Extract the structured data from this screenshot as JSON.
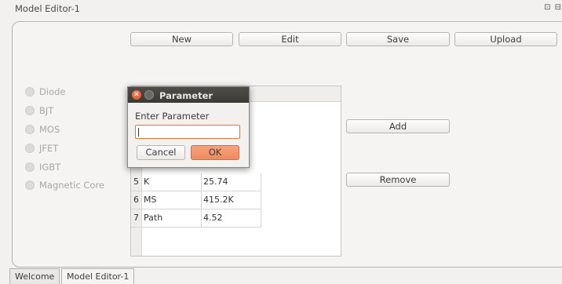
{
  "window": {
    "title": "Model Editor-1",
    "corner_icons": "⊡ ⊟"
  },
  "toolbar": {
    "new_label": "New",
    "edit_label": "Edit",
    "save_label": "Save",
    "upload_label": "Upload"
  },
  "device_types": [
    {
      "label": "Diode"
    },
    {
      "label": "BJT"
    },
    {
      "label": "MOS"
    },
    {
      "label": "JFET"
    },
    {
      "label": "IGBT"
    },
    {
      "label": "Magnetic Core"
    }
  ],
  "parameters": {
    "rows": [
      {
        "index": "5",
        "name": "K",
        "value": "25.74"
      },
      {
        "index": "6",
        "name": "MS",
        "value": "415.2K"
      },
      {
        "index": "7",
        "name": "Path",
        "value": "4.52"
      }
    ]
  },
  "actions": {
    "add_label": "Add",
    "remove_label": "Remove"
  },
  "tabs": [
    {
      "label": "Welcome"
    },
    {
      "label": "Model Editor-1"
    }
  ],
  "dialog": {
    "title": "Parameter",
    "prompt": "Enter Parameter",
    "input_value": "",
    "cancel_label": "Cancel",
    "ok_label": "OK",
    "accent": "#e8722f"
  }
}
